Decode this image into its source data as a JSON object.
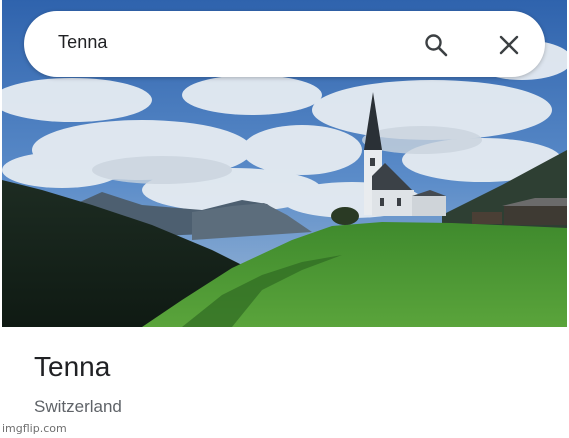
{
  "search": {
    "query": "Tenna"
  },
  "place": {
    "name": "Tenna",
    "region": "Switzerland"
  },
  "icons": {
    "search": "search-icon",
    "close": "close-icon"
  },
  "watermark": "imgflip.com",
  "colors": {
    "sky": "#3a6fb4",
    "grass": "#4e9b3a",
    "mountain": "#1f3325",
    "text_primary": "#202124",
    "text_secondary": "#5f6368"
  }
}
